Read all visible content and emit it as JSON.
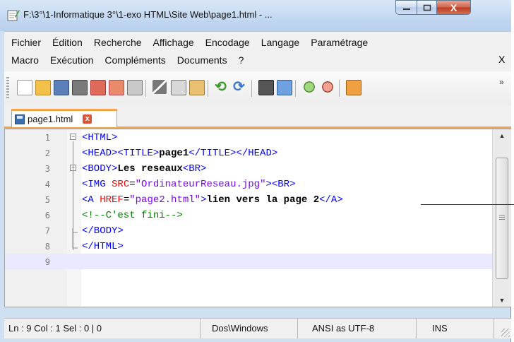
{
  "window": {
    "title": "F:\\3°\\1-Informatique 3°\\1-exo HTML\\Site Web\\page1.html - ...",
    "close_label": "X"
  },
  "menu": {
    "row1": [
      "Fichier",
      "Édition",
      "Recherche",
      "Affichage",
      "Encodage",
      "Langage",
      "Paramétrage"
    ],
    "row2": [
      "Macro",
      "Exécution",
      "Compléments",
      "Documents",
      "?"
    ],
    "close": "X"
  },
  "toolbar": {
    "icons": [
      "new-icon",
      "open-icon",
      "save-icon",
      "save-all-icon",
      "close-icon",
      "close-all-icon",
      "print-icon",
      "cut-icon",
      "copy-icon",
      "paste-icon",
      "undo-icon",
      "redo-icon",
      "find-icon",
      "replace-icon",
      "zoom-in-icon",
      "zoom-out-icon",
      "sync-icon"
    ],
    "more": "»"
  },
  "tab": {
    "label": "page1.html",
    "close": "x"
  },
  "editor": {
    "lines": [
      {
        "n": "1",
        "code": "<HTML>"
      },
      {
        "n": "2",
        "code": "<HEAD><TITLE>page1</TITLE></HEAD>"
      },
      {
        "n": "3",
        "code": "<BODY>Les reseaux<BR>"
      },
      {
        "n": "4",
        "code": "<IMG SRC=\"OrdinateurReseau.jpg\"><BR>"
      },
      {
        "n": "5",
        "code": "<A HREF=\"page2.html\">lien vers la page 2</A>"
      },
      {
        "n": "6",
        "code": "<!--C'est fini-->"
      },
      {
        "n": "7",
        "code": "</BODY>"
      },
      {
        "n": "8",
        "code": "</HTML>"
      },
      {
        "n": "9",
        "code": ""
      }
    ]
  },
  "statusbar": {
    "position": "Ln : 9    Col : 1    Sel : 0 | 0",
    "eol": "Dos\\Windows",
    "encoding": "ANSI as UTF-8",
    "mode": "INS"
  },
  "colors": {
    "tag": "#0000ff",
    "attribute": "#ff0000",
    "value": "#8000ff",
    "comment": "#008000",
    "tab_accent": "#f7a44a"
  }
}
